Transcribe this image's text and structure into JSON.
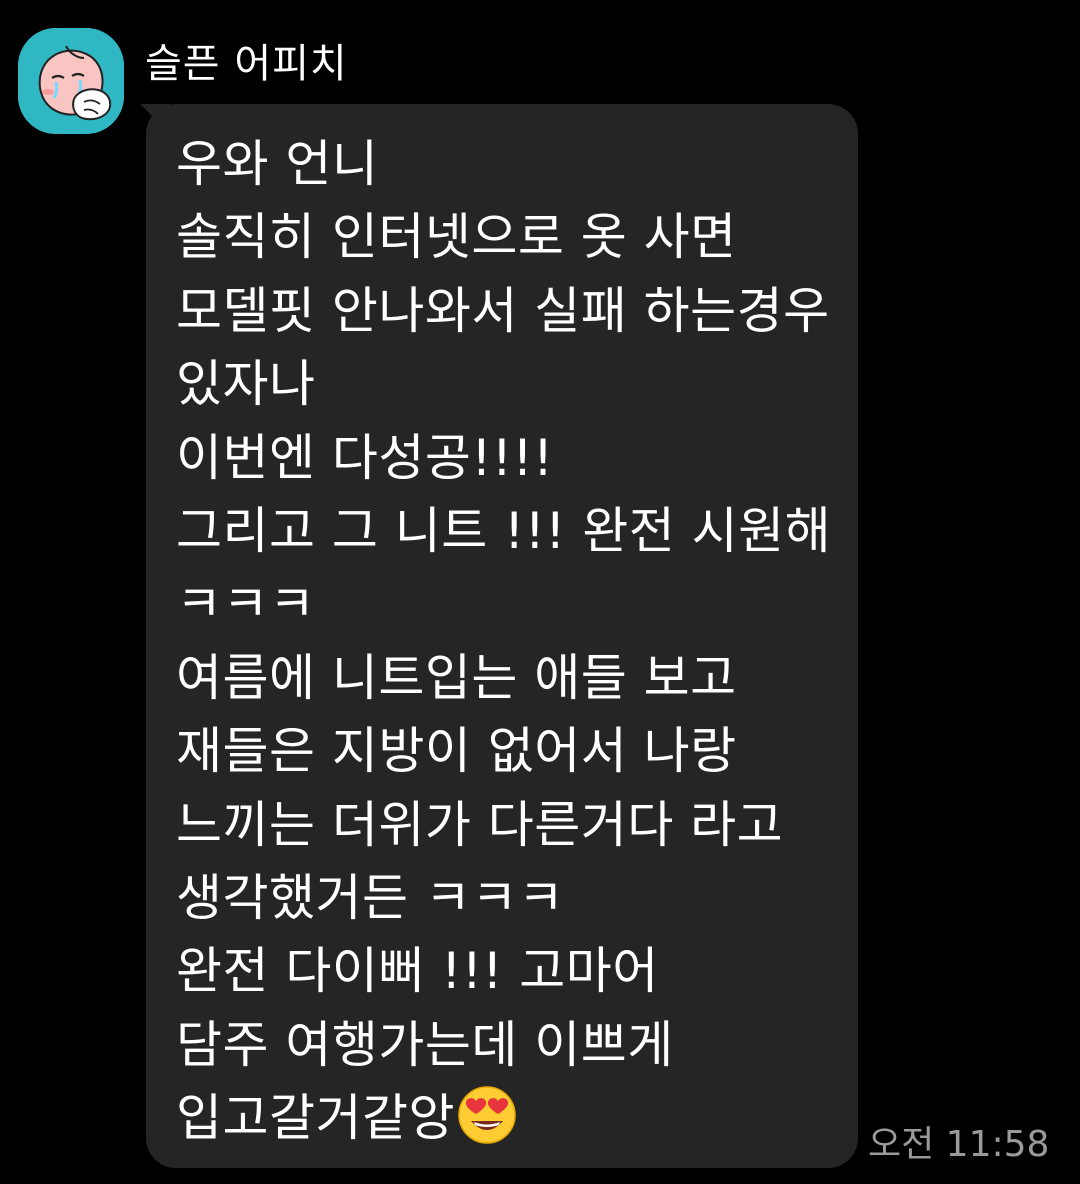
{
  "sender": {
    "name": "슬픈 어피치",
    "avatar_icon": "crying-peach-avatar-icon"
  },
  "message": {
    "lines": [
      "우와 언니",
      "솔직히 인터넷으로 옷 사면",
      "모델핏 안나와서 실패 하는경우",
      "있자나",
      "이번엔 다성공!!!!",
      "그리고 그 니트 !!! 완전 시원해",
      "ㅋㅋㅋ",
      "여름에 니트입는 애들 보고",
      "재들은 지방이 없어서 나랑",
      "느끼는 더위가 다른거다 라고",
      "생각했거든 ㅋㅋㅋ",
      "완전 다이뻐 !!! 고마어",
      "담주 여행가는데 이쁘게",
      "입고갈거같앙"
    ],
    "trailing_emoji": "heart-eyes-emoji-icon",
    "timestamp": "오전 11:58"
  },
  "colors": {
    "background": "#000000",
    "bubble": "#252525",
    "avatar_bg": "#2fb8c3",
    "timestamp": "#9a9a9a"
  }
}
